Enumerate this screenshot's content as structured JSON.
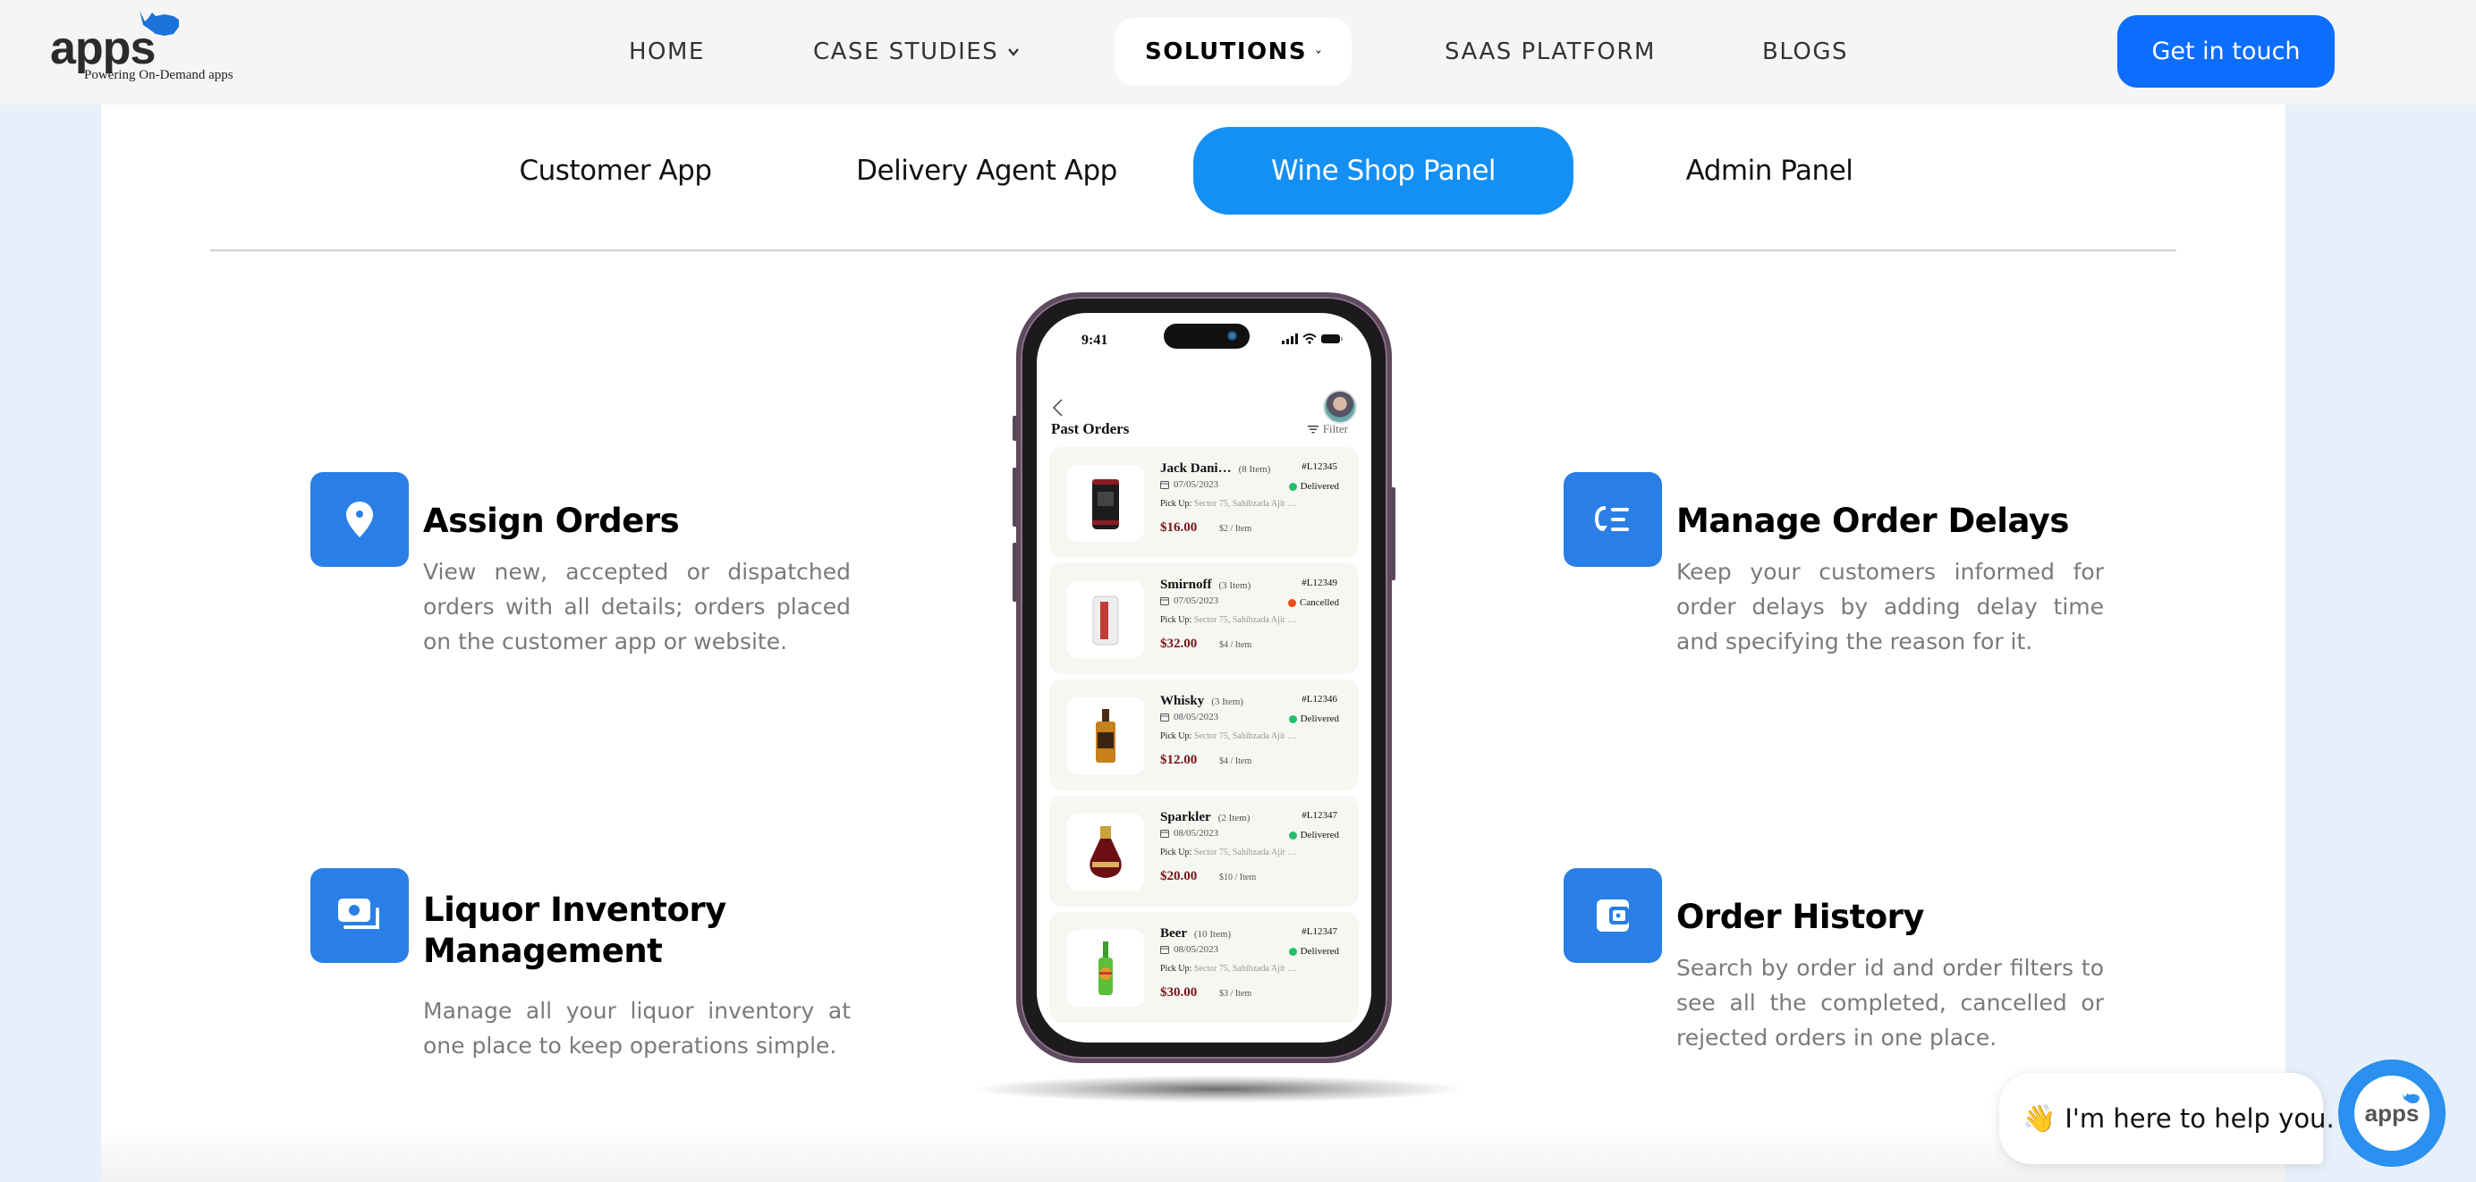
{
  "header": {
    "logo": {
      "word": "apps",
      "tagline": "Powering On-Demand apps"
    },
    "nav": [
      {
        "label": "HOME",
        "dropdown": false,
        "active": false
      },
      {
        "label": "CASE STUDIES",
        "dropdown": true,
        "active": false
      },
      {
        "label": "SOLUTIONS",
        "dropdown": true,
        "active": true
      },
      {
        "label": "SAAS PLATFORM",
        "dropdown": false,
        "active": false
      },
      {
        "label": "BLOGS",
        "dropdown": false,
        "active": false
      }
    ],
    "cta_label": "Get in touch"
  },
  "tabs": [
    {
      "label": "Customer App",
      "active": false
    },
    {
      "label": "Delivery Agent App",
      "active": false
    },
    {
      "label": "Wine Shop Panel",
      "active": true
    },
    {
      "label": "Admin Panel",
      "active": false
    }
  ],
  "features": [
    {
      "icon": "location-pin-icon",
      "title": "Assign Orders",
      "description": "View new, accepted or dispatched orders with all details; orders placed on the customer app or website."
    },
    {
      "icon": "inventory-icon",
      "title": "Liquor Inventory Management",
      "description": "Manage all your liquor inventory at one place to keep operations simple."
    },
    {
      "icon": "delay-list-icon",
      "title": "Manage Order Delays",
      "description": "Keep your customers informed for order delays by adding delay time and specifying the reason for it."
    },
    {
      "icon": "wallet-history-icon",
      "title": "Order History",
      "description": "Search by order id and order filters to see all the completed, cancelled or rejected orders in one place."
    }
  ],
  "phone": {
    "time": "9:41",
    "screen_title": "Past Orders",
    "filter_label": "Filter",
    "pickup_label": "Pick Up:",
    "orders": [
      {
        "name": "Jack Dani…",
        "qty": "(8 Item)",
        "id": "#L12345",
        "date": "07/05/2023",
        "status": "Delivered",
        "pickup": "Sector 75, Sahibzada Ajit …",
        "price": "$16.00",
        "unit": "$2 / Item",
        "product": "can-dark"
      },
      {
        "name": "Smirnoff",
        "qty": "(3 Item)",
        "id": "#L12349",
        "date": "07/05/2023",
        "status": "Cancelled",
        "pickup": "Sector 75, Sahibzada Ajit …",
        "price": "$32.00",
        "unit": "$4 / Item",
        "product": "can-white"
      },
      {
        "name": "Whisky",
        "qty": "(3 Item)",
        "id": "#L12346",
        "date": "08/05/2023",
        "status": "Delivered",
        "pickup": "Sector 75, Sahibzada Ajit …",
        "price": "$12.00",
        "unit": "$4 / Item",
        "product": "bottle-whisky"
      },
      {
        "name": "Sparkler",
        "qty": "(2 Item)",
        "id": "#L12347",
        "date": "08/05/2023",
        "status": "Delivered",
        "pickup": "Sector 75, Sahibzada Ajit …",
        "price": "$20.00",
        "unit": "$10 / Item",
        "product": "bottle-round"
      },
      {
        "name": "Beer",
        "qty": "(10 Item)",
        "id": "#L12347",
        "date": "08/05/2023",
        "status": "Delivered",
        "pickup": "Sector 75, Sahibzada Ajit …",
        "price": "$30.00",
        "unit": "$3 / Item",
        "product": "bottle-beer"
      }
    ]
  },
  "chat": {
    "wave_emoji": "👋",
    "message": "I'm here to help you.",
    "launcher_word": "apps"
  },
  "colors": {
    "brand_blue": "#0d6efd",
    "tab_active": "#1490f5",
    "icon_tile": "#2a7fe6",
    "delivered": "#22c06b",
    "cancelled": "#f04e14",
    "price": "#7a1418"
  }
}
